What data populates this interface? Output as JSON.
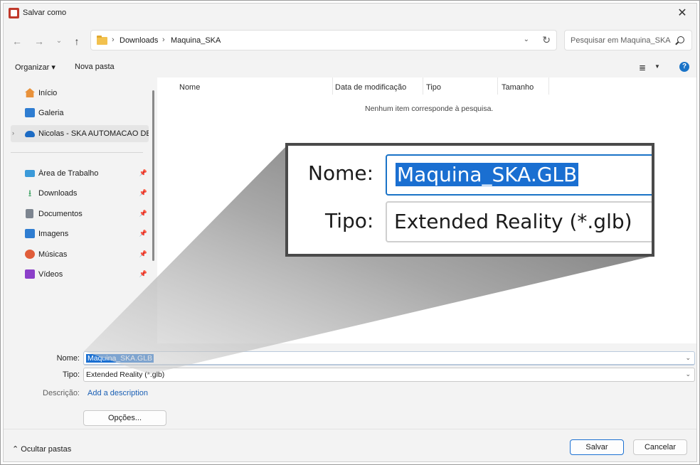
{
  "window": {
    "title": "Salvar como",
    "close_glyph": "✕"
  },
  "nav": {
    "back": "←",
    "forward": "→",
    "recent": "⌄",
    "up": "↑"
  },
  "address": {
    "crumbs": [
      "Downloads",
      "Maquina_SKA"
    ],
    "separator": "›",
    "dropdown": "⌄",
    "refresh": "↻"
  },
  "search": {
    "placeholder": "Pesquisar em Maquina_SKA"
  },
  "toolbar": {
    "organize": "Organizar ▾",
    "new_folder": "Nova pasta",
    "view_glyph": "≣",
    "view_dd": "▼",
    "help": "?"
  },
  "sidebar": {
    "top": [
      {
        "label": "Início",
        "icon": "home-icon",
        "color": "#e8913a"
      },
      {
        "label": "Galeria",
        "icon": "gallery-icon",
        "color": "#2f7dd1"
      },
      {
        "label": "Nicolas - SKA AUTOMACAO DE E",
        "icon": "onedrive-icon",
        "color": "#1c6bc4",
        "chevron": "›"
      }
    ],
    "pinned": [
      {
        "label": "Área de Trabalho",
        "icon": "desktop-icon",
        "color": "#3b9ad9"
      },
      {
        "label": "Downloads",
        "icon": "download-icon",
        "color": "#2e9b57"
      },
      {
        "label": "Documentos",
        "icon": "documents-icon",
        "color": "#7d8590"
      },
      {
        "label": "Imagens",
        "icon": "pictures-icon",
        "color": "#2f7dd1"
      },
      {
        "label": "Músicas",
        "icon": "music-icon",
        "color": "#e05d3a"
      },
      {
        "label": "Vídeos",
        "icon": "videos-icon",
        "color": "#8b3fc9"
      }
    ],
    "pin_glyph": "📌"
  },
  "columns": [
    "Nome",
    "Data de modificação",
    "Tipo",
    "Tamanho"
  ],
  "empty_message": "Nenhum item corresponde à pesquisa.",
  "zoom": {
    "name_label": "Nome:",
    "name_value": "Maquina_SKA.GLB",
    "type_label": "Tipo:",
    "type_value": "Extended Reality (*.glb)"
  },
  "form": {
    "name_label": "Nome:",
    "name_value": "Maquina_SKA.GLB",
    "type_label": "Tipo:",
    "type_value": "Extended Reality (*.glb)",
    "desc_label": "Descrição:",
    "desc_link": "Add a description",
    "options_button": "Opções...",
    "dd_glyph": "⌄"
  },
  "footer": {
    "hide_folders": "⌃  Ocultar pastas",
    "save": "Salvar",
    "cancel": "Cancelar"
  },
  "colors": {
    "accent": "#1a6fd1",
    "selection": "#1a6fd1",
    "link": "#1a5fb4"
  }
}
